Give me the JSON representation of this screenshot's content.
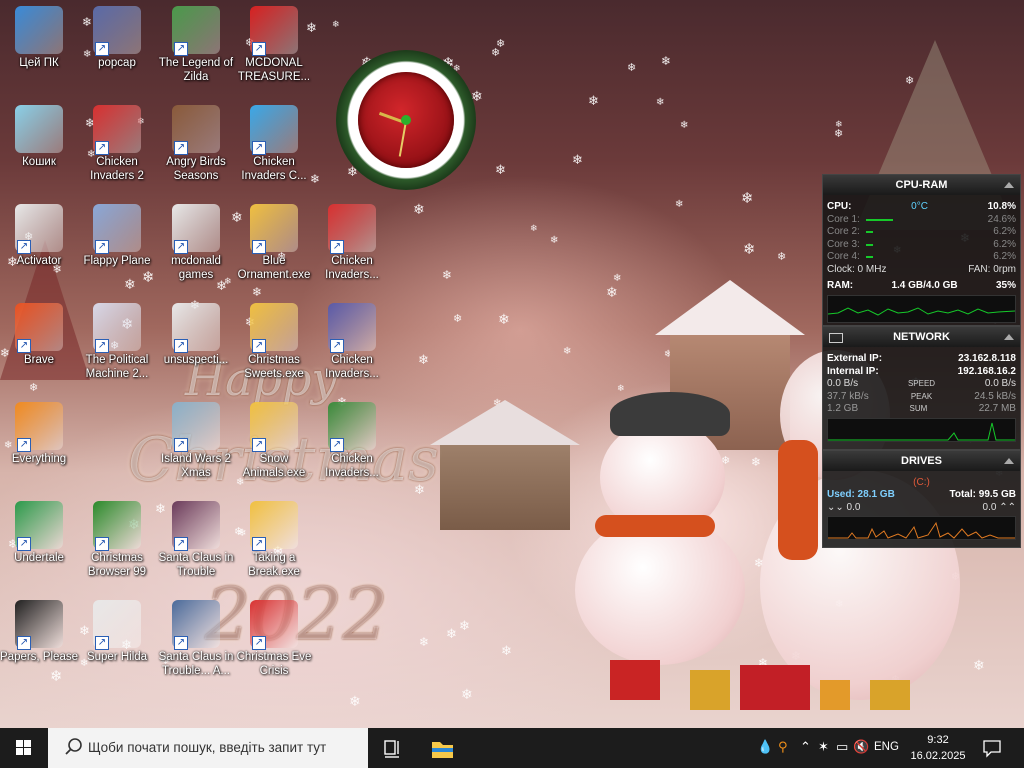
{
  "desktop": {
    "greeting_line1": "Happy",
    "greeting_line2": "Christmas",
    "greeting_year": "2022",
    "icons": [
      {
        "label": "Цей ПК"
      },
      {
        "label": "popcap"
      },
      {
        "label": "The Legend of Zilda"
      },
      {
        "label": "MCDONAL TREASURE..."
      },
      {
        "label": "Кошик"
      },
      {
        "label": "Chicken Invaders 2"
      },
      {
        "label": "Angry Birds Seasons"
      },
      {
        "label": "Chicken Invaders C..."
      },
      {
        "label": "Activator"
      },
      {
        "label": "Flappy Plane"
      },
      {
        "label": "mcdonald games"
      },
      {
        "label": "Blue Ornament.exe"
      },
      {
        "label": "Chicken Invaders..."
      },
      {
        "label": "Brave"
      },
      {
        "label": "The Political Machine 2..."
      },
      {
        "label": "unsuspecti..."
      },
      {
        "label": "Christmas Sweets.exe"
      },
      {
        "label": "Chicken Invaders..."
      },
      {
        "label": "Everything"
      },
      {
        "label": "Island Wars 2 Xmas"
      },
      {
        "label": "Snow Animals.exe"
      },
      {
        "label": "Chicken Invaders..."
      },
      {
        "label": "Undertale"
      },
      {
        "label": "Christmas Browser 99"
      },
      {
        "label": "Santa Claus in Trouble"
      },
      {
        "label": "Taking a Break.exe"
      },
      {
        "label": "Papers, Please"
      },
      {
        "label": "Super Hilda"
      },
      {
        "label": "Santa Claus in Trouble... A..."
      },
      {
        "label": "Christmas Eve Crisis"
      }
    ]
  },
  "cpu_ram": {
    "title": "CPU-RAM",
    "cpu_label": "CPU:",
    "cpu_temp": "0°C",
    "cpu_load": "10.8%",
    "cores": [
      {
        "label": "Core 1:",
        "value": "24.6%",
        "load": 0.246
      },
      {
        "label": "Core 2:",
        "value": "6.2%",
        "load": 0.062
      },
      {
        "label": "Core 3:",
        "value": "6.2%",
        "load": 0.062
      },
      {
        "label": "Core 4:",
        "value": "6.2%",
        "load": 0.062
      }
    ],
    "clock": "Clock: 0 MHz",
    "fan": "FAN: 0rpm",
    "ram_label": "RAM:",
    "ram_value": "1.4 GB/4.0 GB",
    "ram_pct": "35%"
  },
  "network": {
    "title": "NETWORK",
    "external_label": "External IP:",
    "external_ip": "23.162.8.118",
    "internal_label": "Internal IP:",
    "internal_ip": "192.168.16.2",
    "rows": [
      {
        "left": "0.0 B/s",
        "mid": "SPEED",
        "right": "0.0 B/s"
      },
      {
        "left": "37.7 kB/s",
        "mid": "PEAK",
        "right": "24.5 kB/s"
      },
      {
        "left": "1.2 GB",
        "mid": "SUM",
        "right": "22.7 MB"
      }
    ]
  },
  "drives": {
    "title": "DRIVES",
    "drive": "(C:)",
    "used": "Used: 28.1 GB",
    "total": "Total: 99.5 GB",
    "read": "0.0",
    "write": "0.0"
  },
  "taskbar": {
    "search_placeholder": "Щоби почати пошук, введіть запит тут",
    "lang": "ENG",
    "time": "9:32",
    "date": "16.02.2025"
  },
  "colors": {
    "taskbar": "#1c1c1c",
    "graph_green": "#16c92a",
    "drive_graph": "#e07a22",
    "accent_red": "#d2262b"
  }
}
